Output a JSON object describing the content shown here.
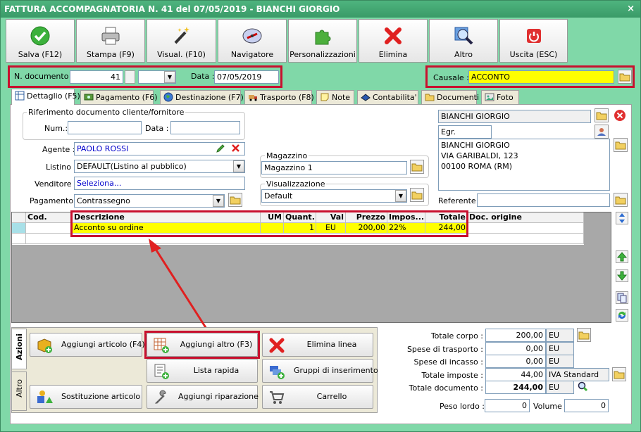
{
  "window": {
    "title": "FATTURA ACCOMPAGNATORIA N. 41 del 07/05/2019 - BIANCHI GIORGIO",
    "close": "×"
  },
  "toolbar": [
    {
      "label": "Salva (F12)",
      "icon": "check-icon"
    },
    {
      "label": "Stampa (F9)",
      "icon": "printer-icon"
    },
    {
      "label": "Visual. (F10)",
      "icon": "magic-wand-icon"
    },
    {
      "label": "Navigatore",
      "icon": "compass-icon"
    },
    {
      "label": "Personalizzazioni",
      "icon": "puzzle-icon"
    },
    {
      "label": "Elimina",
      "icon": "red-x-icon"
    },
    {
      "label": "Altro",
      "icon": "magnifier-icon"
    },
    {
      "label": "Uscita (ESC)",
      "icon": "power-icon"
    }
  ],
  "header": {
    "ndoc_label": "N. documento :",
    "ndoc_value": "41",
    "series_value": "",
    "date_label": "Data :",
    "date_value": "07/05/2019",
    "causale_label": "Causale :",
    "causale_value": "ACCONTO"
  },
  "tabs": [
    "Dettaglio (F5)",
    "Pagamento (F6)",
    "Destinazione (F7)",
    "Trasporto (F8)",
    "Note",
    "Contabilita'",
    "Documenti",
    "Foto"
  ],
  "rif": {
    "title": "Riferimento documento cliente/fornitore",
    "num_label": "Num.:",
    "num_value": "",
    "data_label": "Data :",
    "data_value": ""
  },
  "fields": {
    "agente_label": "Agente :",
    "agente_value": "PAOLO ROSSI",
    "listino_label": "Listino :",
    "listino_value": "DEFAULT(Listino al pubblico)",
    "venditore_label": "Venditore :",
    "venditore_value": "Seleziona...",
    "pagamento_label": "Pagamento :",
    "pagamento_value": "Contrassegno",
    "magazzino_title": "Magazzino",
    "magazzino_value": "Magazzino 1",
    "visualizzazione_title": "Visualizzazione",
    "visualizzazione_value": "Default"
  },
  "client": {
    "name": "BIANCHI GIORGIO",
    "title": "Egr.",
    "address": [
      "BIANCHI GIORGIO",
      "VIA GARIBALDI, 123",
      "00100 ROMA (RM)"
    ],
    "referente_label": "Referente",
    "referente_value": ""
  },
  "grid": {
    "columns": [
      "Cod.",
      "Descrizione",
      "UM",
      "Quant.",
      "Val",
      "Prezzo",
      "Impos...",
      "Totale",
      "Doc. origine"
    ],
    "rows": [
      {
        "cod": "",
        "descrizione": "Acconto su ordine",
        "um": "",
        "quant": "1",
        "val": "EU",
        "prezzo": "200,00",
        "impos": "22%",
        "totale": "244,00",
        "doc": ""
      }
    ]
  },
  "actions": {
    "vtabs": [
      "Azioni",
      "Altro"
    ],
    "buttons": [
      "Aggiungi articolo (F4)",
      "Aggiungi altro (F3)",
      "Elimina linea",
      "Lista rapida",
      "Gruppi di inserimento",
      "Sostituzione articolo",
      "Aggiungi riparazione",
      "Carrello"
    ]
  },
  "totals": [
    {
      "label": "Totale corpo :",
      "value": "200,00",
      "unit": "EU"
    },
    {
      "label": "Spese di trasporto :",
      "value": "0,00",
      "unit": "EU"
    },
    {
      "label": "Spese di incasso :",
      "value": "0,00",
      "unit": "EU"
    },
    {
      "label": "Totale imposte :",
      "value": "44,00",
      "unit": "IVA Standard"
    },
    {
      "label": "Totale documento :",
      "value": "244,00",
      "unit": "EU"
    }
  ],
  "weights": {
    "peso_label": "Peso lordo :",
    "peso_value": "0",
    "volume_label": "Volume :",
    "volume_value": "0"
  },
  "colors": {
    "title_bar": "#3a9a68",
    "window_bg": "#80d8a8",
    "highlight": "#ffff00",
    "annotation_red": "#c8102e",
    "link_blue": "#0000cc"
  }
}
